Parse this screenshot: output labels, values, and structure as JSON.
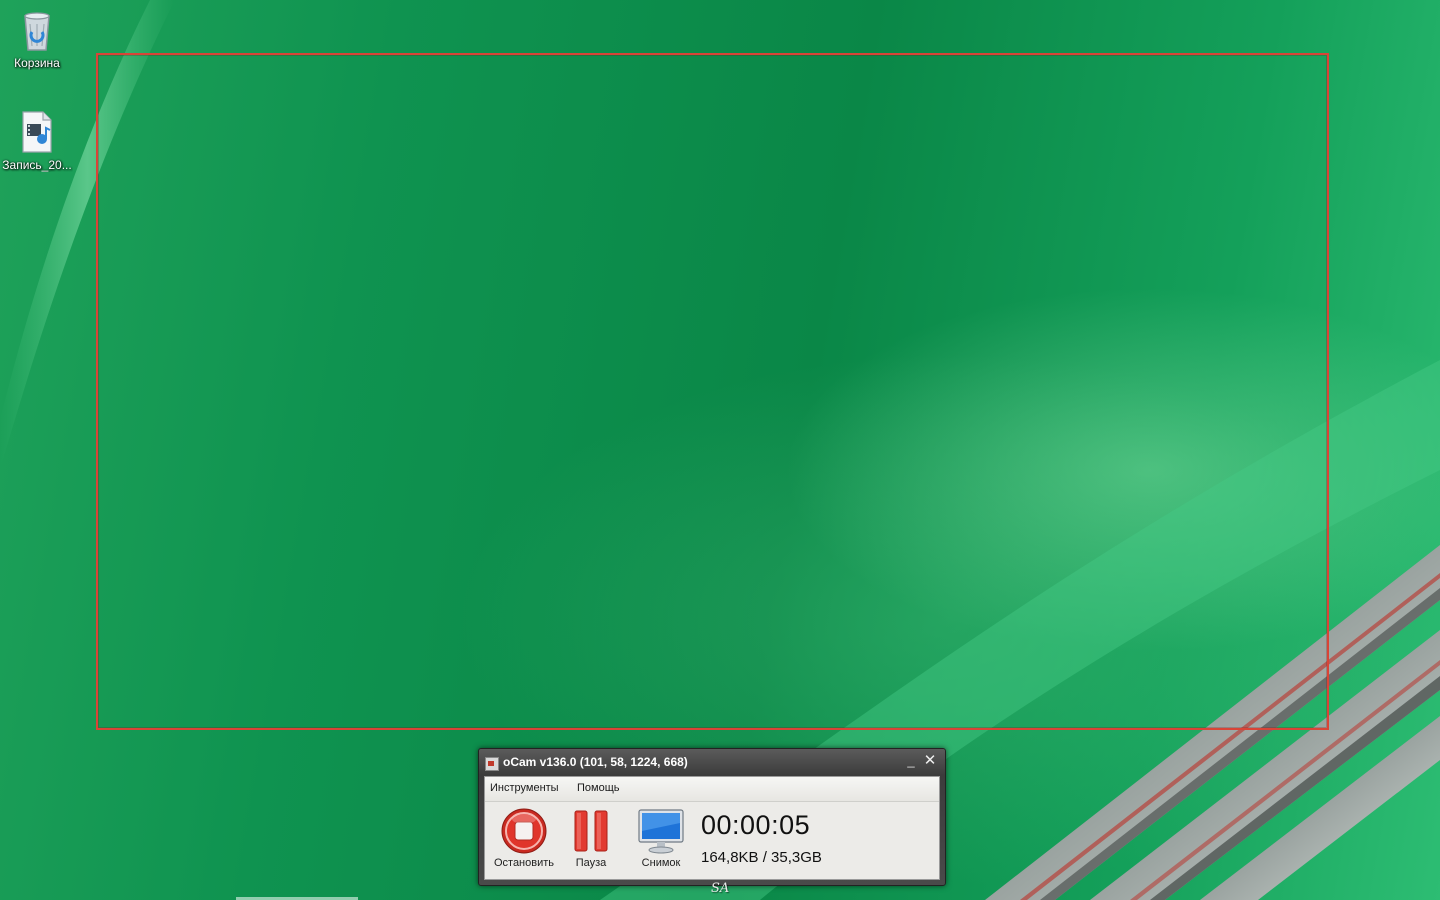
{
  "desktop": {
    "icons": [
      {
        "label": "Корзина",
        "icon": "recycle-bin-icon"
      },
      {
        "label": "Запись_20...",
        "icon": "video-file-icon"
      }
    ]
  },
  "capture_region": {
    "border_color": "#d94437"
  },
  "ocam": {
    "title": "oCam v136.0 (101, 58, 1224, 668)",
    "minimize_glyph": "_",
    "close_glyph": "✕",
    "menu": {
      "tools": "Инструменты",
      "help": "Помощь"
    },
    "buttons": {
      "stop": {
        "label": "Остановить",
        "icon": "stop-icon"
      },
      "pause": {
        "label": "Пауза",
        "icon": "pause-icon"
      },
      "snapshot": {
        "label": "Снимок",
        "icon": "monitor-icon"
      }
    },
    "timer": "00:00:05",
    "size": "164,8KB / 35,3GB"
  },
  "watermark": "SA",
  "colors": {
    "wallpaper": "#0c8a49",
    "frame": "#d94437",
    "stop_red": "#e0352b",
    "window_chrome": "#3c3c3c"
  }
}
